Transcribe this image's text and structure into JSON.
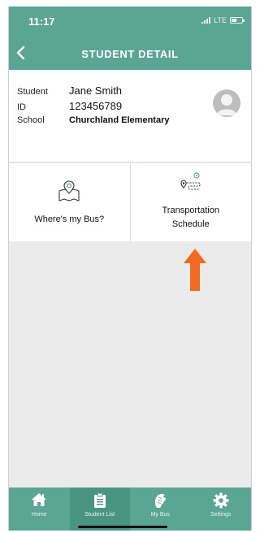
{
  "status_bar": {
    "time": "11:17",
    "network": "LTE"
  },
  "header": {
    "title": "STUDENT DETAIL",
    "back_icon": "chevron-left-icon",
    "color": "#5aa594"
  },
  "student": {
    "name_label": "Student",
    "name": "Jane Smith",
    "id_label": "ID",
    "id": "123456789",
    "school_label": "School",
    "school": "Churchland Elementary",
    "avatar_icon": "person-avatar-icon"
  },
  "tiles": [
    {
      "label": "Where's my Bus?",
      "icon": "map-pin-icon"
    },
    {
      "label_line1": "Transportation",
      "label_line2": "Schedule",
      "icon": "route-icon"
    }
  ],
  "annotation": {
    "icon": "arrow-up-icon",
    "color": "#f26a21"
  },
  "tab_bar": {
    "active_color": "#4a9483",
    "tabs": [
      {
        "label": "Home",
        "icon": "home-icon"
      },
      {
        "label": "Student List",
        "icon": "clipboard-icon",
        "active": true
      },
      {
        "label": "My Bus",
        "icon": "bus-mascot-icon"
      },
      {
        "label": "Settings",
        "icon": "gear-icon"
      }
    ]
  }
}
